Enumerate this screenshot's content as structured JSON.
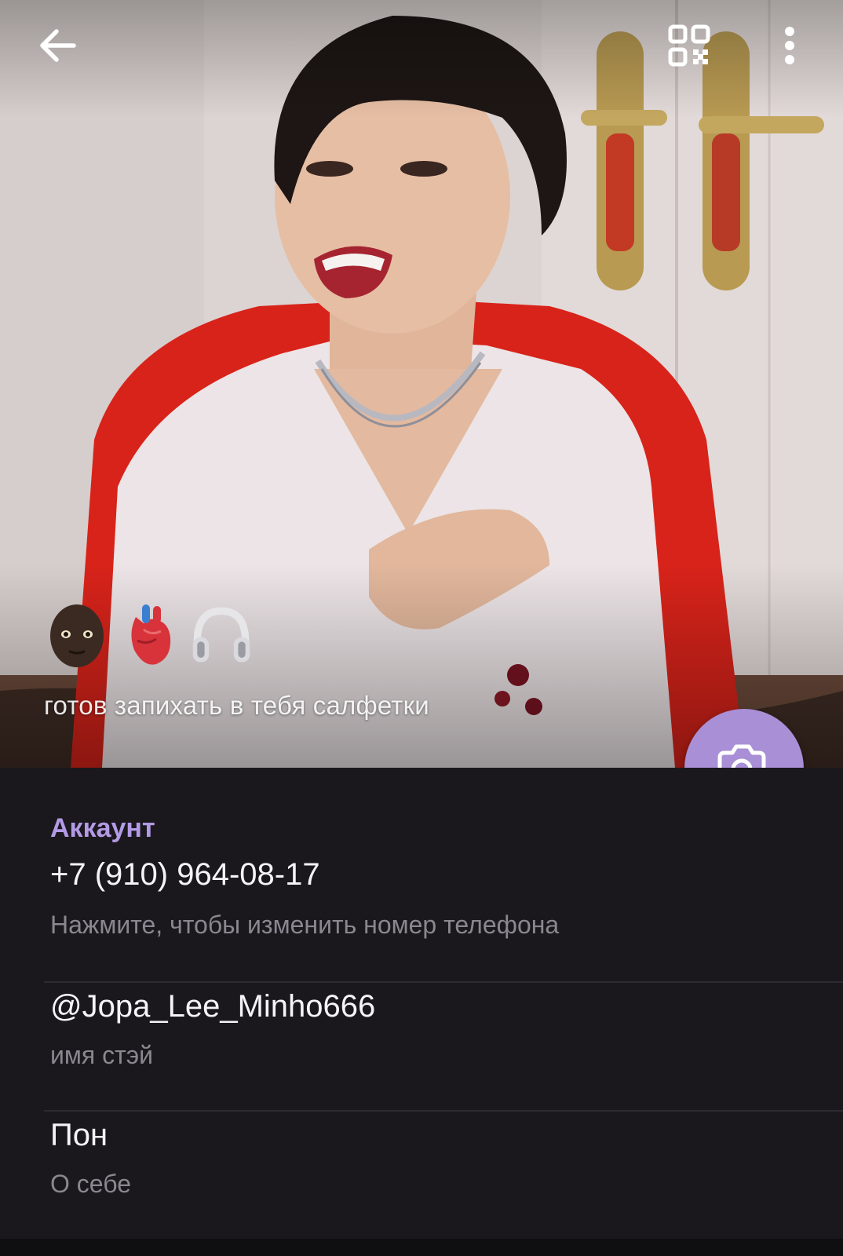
{
  "header": {
    "bio_caption": "готов запихать в тебя салфетки",
    "emojis": [
      "person-emoji",
      "anatomical-heart-emoji",
      "headphones-emoji"
    ]
  },
  "account": {
    "section_title": "Аккаунт",
    "phone": {
      "value": "+7 (910) 964-08-17",
      "hint": "Нажмите, чтобы изменить номер телефона"
    },
    "username": {
      "value": "@Jopa_Lee_Minho666",
      "hint": "имя стэй"
    },
    "bio": {
      "value": "Пон",
      "hint": "О себе"
    }
  },
  "colors": {
    "accent": "#b39ae6",
    "fab": "#a98fd6",
    "background": "#1a181d",
    "hint": "#8a8790"
  }
}
